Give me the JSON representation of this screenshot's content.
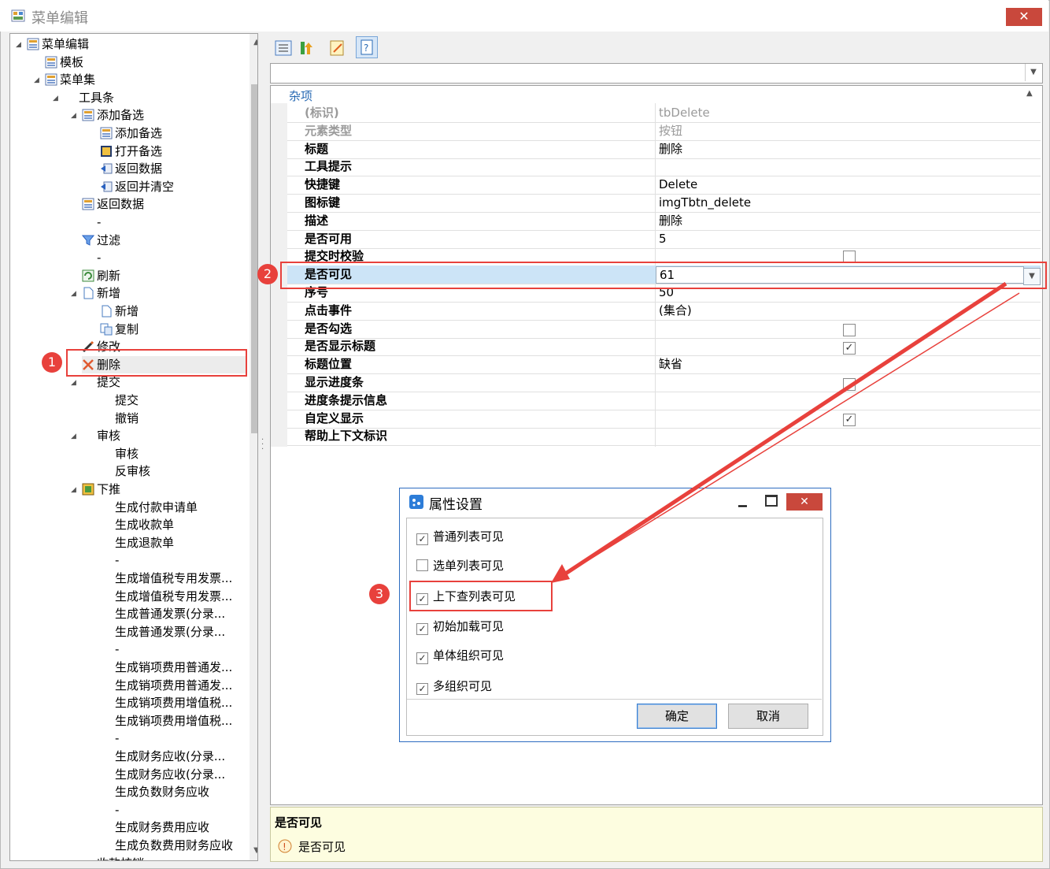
{
  "window": {
    "title": "菜单编辑",
    "close": "✕"
  },
  "tree": {
    "nodes": [
      {
        "label": "菜单编辑"
      },
      {
        "label": "模板"
      },
      {
        "label": "菜单集"
      },
      {
        "label": "工具条"
      },
      {
        "label": "添加备选"
      },
      {
        "label": "添加备选"
      },
      {
        "label": "打开备选"
      },
      {
        "label": "返回数据"
      },
      {
        "label": "返回并清空"
      },
      {
        "label": "返回数据"
      },
      {
        "label": "-"
      },
      {
        "label": "过滤"
      },
      {
        "label": "-"
      },
      {
        "label": "刷新"
      },
      {
        "label": "新增"
      },
      {
        "label": "新增"
      },
      {
        "label": "复制"
      },
      {
        "label": "修改"
      },
      {
        "label": "删除"
      },
      {
        "label": "提交"
      },
      {
        "label": "提交"
      },
      {
        "label": "撤销"
      },
      {
        "label": "审核"
      },
      {
        "label": "审核"
      },
      {
        "label": "反审核"
      },
      {
        "label": "下推"
      },
      {
        "label": "生成付款申请单"
      },
      {
        "label": "生成收款单"
      },
      {
        "label": "生成退款单"
      },
      {
        "label": "-"
      },
      {
        "label": "生成增值税专用发票..."
      },
      {
        "label": "生成增值税专用发票..."
      },
      {
        "label": "生成普通发票(分录..."
      },
      {
        "label": "生成普通发票(分录..."
      },
      {
        "label": "-"
      },
      {
        "label": "生成销项费用普通发..."
      },
      {
        "label": "生成销项费用普通发..."
      },
      {
        "label": "生成销项费用增值税..."
      },
      {
        "label": "生成销项费用增值税..."
      },
      {
        "label": "-"
      },
      {
        "label": "生成财务应收(分录..."
      },
      {
        "label": "生成财务应收(分录..."
      },
      {
        "label": "生成负数财务应收"
      },
      {
        "label": "-"
      },
      {
        "label": "生成财务费用应收"
      },
      {
        "label": "生成负数费用财务应收"
      },
      {
        "label": "收款核销"
      }
    ]
  },
  "property_grid": {
    "category": "杂项",
    "rows": [
      {
        "name": "(标识)",
        "value": "tbDelete"
      },
      {
        "name": "元素类型",
        "value": "按钮"
      },
      {
        "name": "标题",
        "value": "删除"
      },
      {
        "name": "工具提示",
        "value": ""
      },
      {
        "name": "快捷键",
        "value": "Delete"
      },
      {
        "name": "图标键",
        "value": "imgTbtn_delete"
      },
      {
        "name": "描述",
        "value": "删除"
      },
      {
        "name": "是否可用",
        "value": "5"
      },
      {
        "name": "提交时校验",
        "value": ""
      },
      {
        "name": "是否可见",
        "value": "61"
      },
      {
        "name": "序号",
        "value": "50"
      },
      {
        "name": "点击事件",
        "value": "(集合)"
      },
      {
        "name": "是否勾选",
        "value": ""
      },
      {
        "name": "是否显示标题",
        "value": ""
      },
      {
        "name": "标题位置",
        "value": "缺省"
      },
      {
        "name": "显示进度条",
        "value": ""
      },
      {
        "name": "进度条提示信息",
        "value": ""
      },
      {
        "name": "自定义显示",
        "value": ""
      },
      {
        "name": "帮助上下文标识",
        "value": ""
      }
    ],
    "checks": {
      "submit_validate": false,
      "is_checked": false,
      "show_title": true,
      "show_progress": false,
      "custom_display": true
    }
  },
  "help": {
    "title": "是否可见",
    "desc": "是否可见"
  },
  "dialog": {
    "title": "属性设置",
    "options": [
      {
        "label": "普通列表可见",
        "checked": true
      },
      {
        "label": "选单列表可见",
        "checked": false
      },
      {
        "label": "上下查列表可见",
        "checked": true
      },
      {
        "label": "初始加载可见",
        "checked": true
      },
      {
        "label": "单体组织可见",
        "checked": true
      },
      {
        "label": "多组织可见",
        "checked": true
      }
    ],
    "ok": "确定",
    "cancel": "取消"
  },
  "annotations": {
    "badge1": "1",
    "badge2": "2",
    "badge3": "3"
  },
  "colors": {
    "annotation": "#e8413c",
    "category_text": "#2a6bb4",
    "selected_row": "#cce4f7",
    "dialog_border": "#2d6cc0"
  }
}
